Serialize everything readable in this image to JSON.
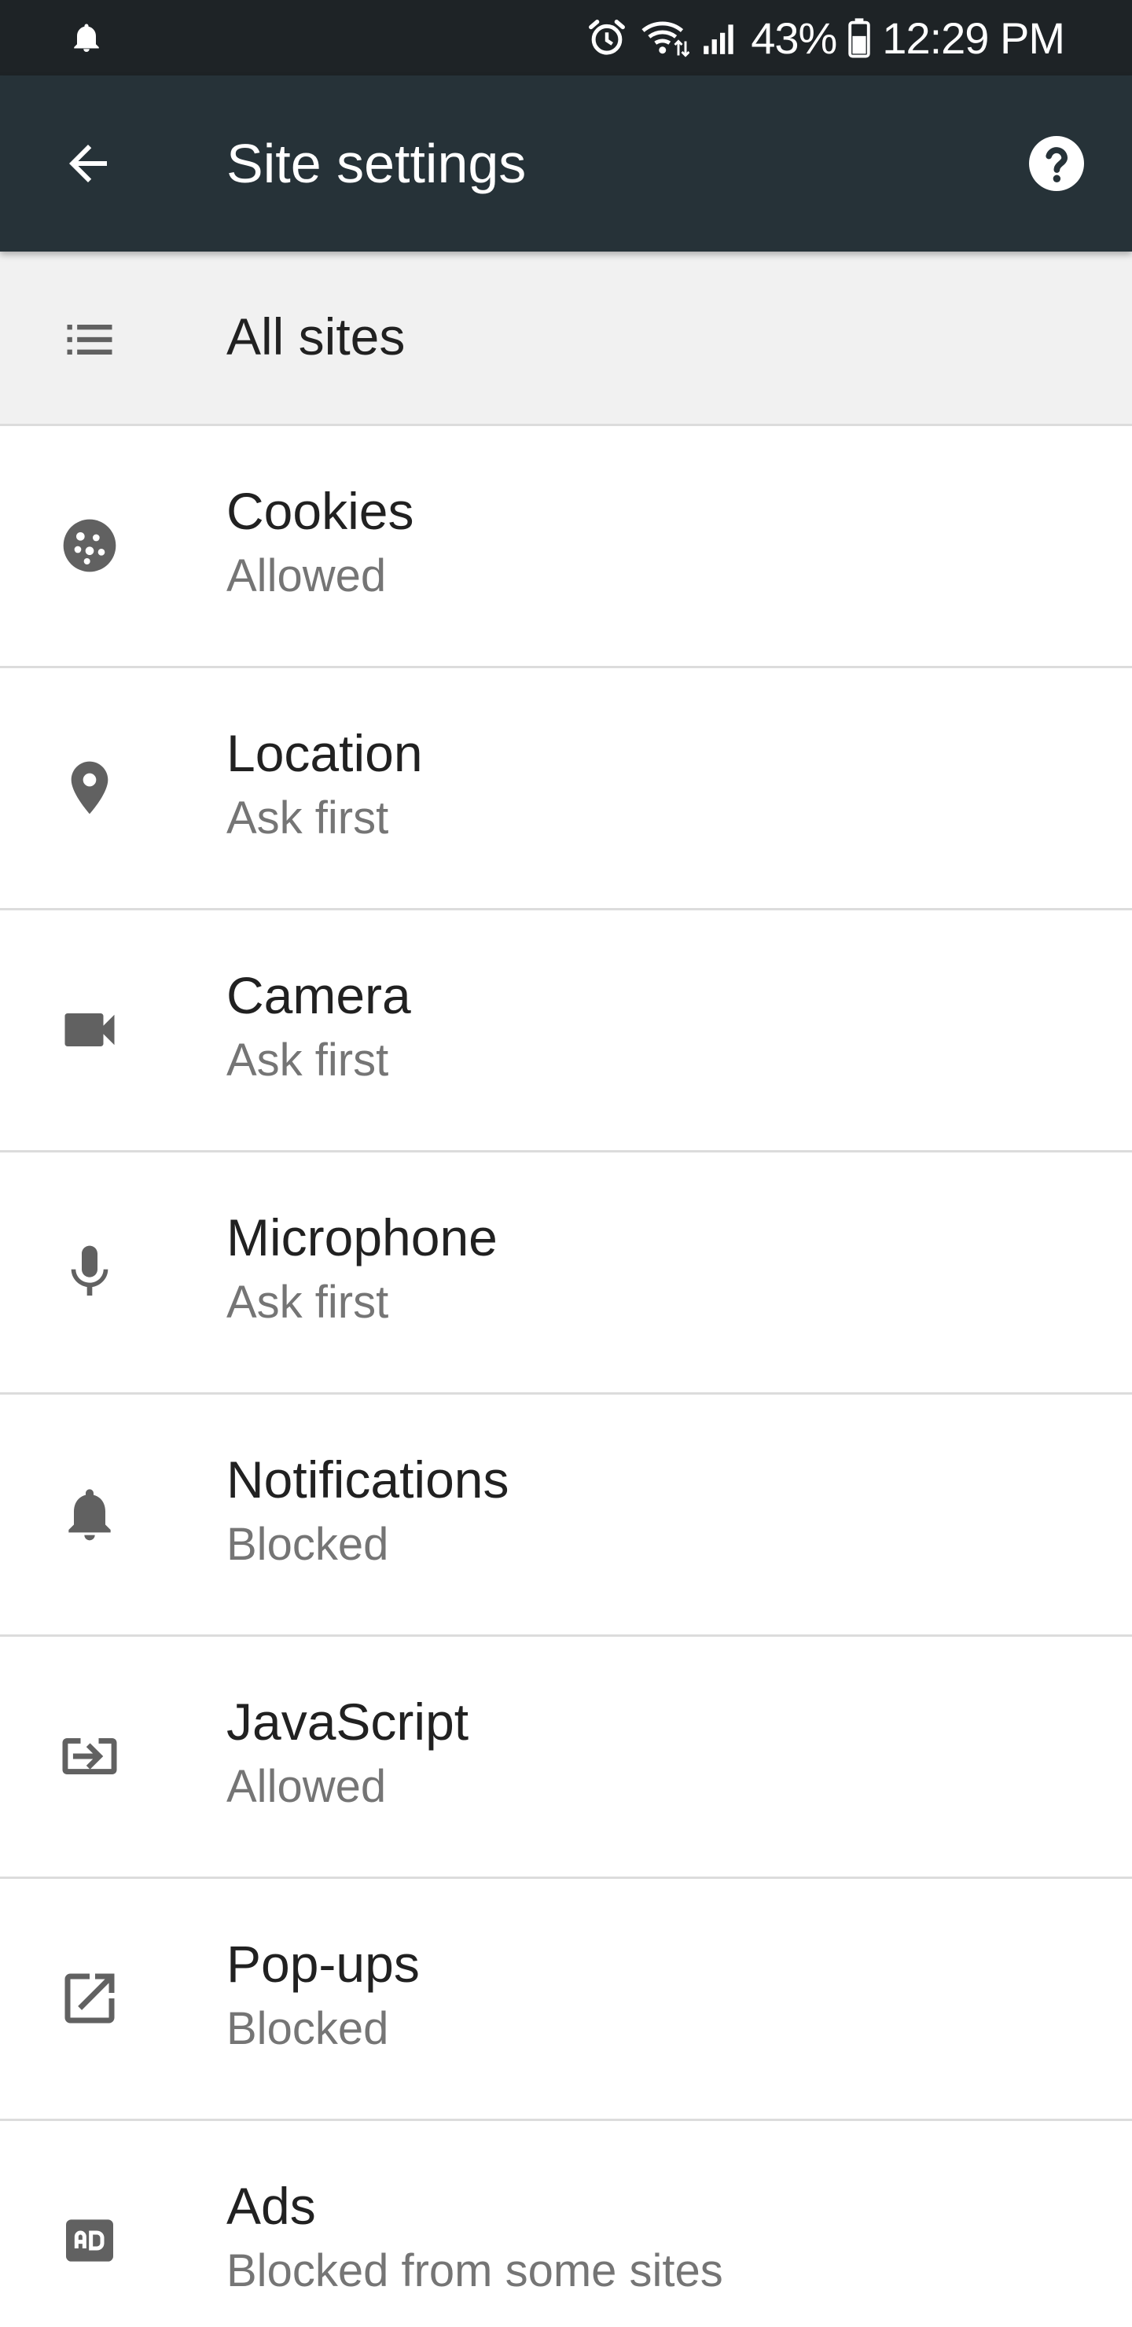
{
  "status_bar": {
    "battery_percent": "43%",
    "time": "12:29 PM",
    "icons": [
      "notification-bell-icon",
      "alarm-icon",
      "wifi-icon",
      "signal-icon",
      "battery-icon"
    ]
  },
  "app_bar": {
    "title": "Site settings",
    "back_icon": "arrow-back-icon",
    "help_icon": "help-icon",
    "color": "#263238"
  },
  "all_sites": {
    "label": "All sites",
    "icon": "list-icon"
  },
  "settings": [
    {
      "title": "Cookies",
      "value": "Allowed",
      "icon": "cookie-icon"
    },
    {
      "title": "Location",
      "value": "Ask first",
      "icon": "location-pin-icon"
    },
    {
      "title": "Camera",
      "value": "Ask first",
      "icon": "videocam-icon"
    },
    {
      "title": "Microphone",
      "value": "Ask first",
      "icon": "mic-icon"
    },
    {
      "title": "Notifications",
      "value": "Blocked",
      "icon": "notifications-icon"
    },
    {
      "title": "JavaScript",
      "value": "Allowed",
      "icon": "javascript-icon"
    },
    {
      "title": "Pop-ups",
      "value": "Blocked",
      "icon": "open-in-new-icon"
    },
    {
      "title": "Ads",
      "value": "Blocked from some sites",
      "icon": "ads-icon"
    }
  ],
  "colors": {
    "status_bar": "#1e2326",
    "icon_gray": "#616161",
    "title_text": "#212121",
    "subtitle_text": "#757575",
    "divider": "#dcdcdc"
  }
}
